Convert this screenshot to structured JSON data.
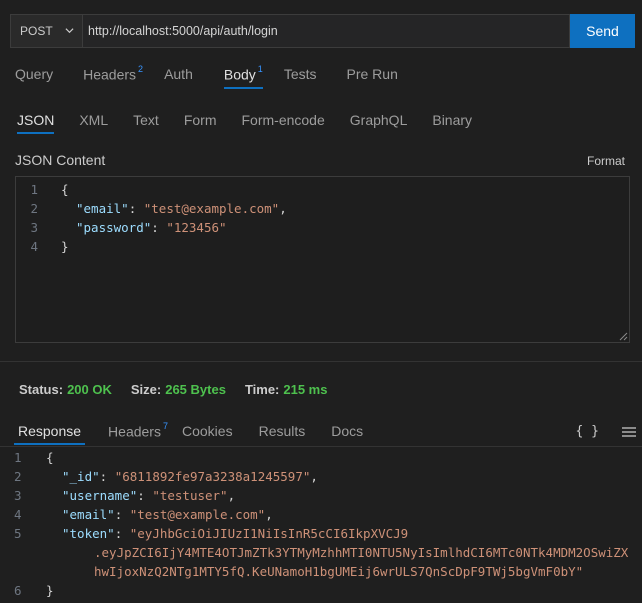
{
  "request": {
    "method": "POST",
    "url": "http://localhost:5000/api/auth/login",
    "send_label": "Send",
    "tabs": [
      {
        "label": "Query",
        "badge": ""
      },
      {
        "label": "Headers",
        "badge": "2"
      },
      {
        "label": "Auth",
        "badge": ""
      },
      {
        "label": "Body",
        "badge": "1"
      },
      {
        "label": "Tests",
        "badge": ""
      },
      {
        "label": "Pre Run",
        "badge": ""
      }
    ],
    "body_types": [
      "JSON",
      "XML",
      "Text",
      "Form",
      "Form-encode",
      "GraphQL",
      "Binary"
    ],
    "content_label": "JSON Content",
    "format_label": "Format",
    "body_lines": [
      {
        "n": "1",
        "open": "{"
      },
      {
        "n": "2",
        "key": "\"email\"",
        "value": "\"test@example.com\"",
        "end": ","
      },
      {
        "n": "3",
        "key": "\"password\"",
        "value": "\"123456\"",
        "end": ""
      },
      {
        "n": "4",
        "open": "}"
      }
    ]
  },
  "status": {
    "status_label": "Status:",
    "status_value": "200 OK",
    "size_label": "Size:",
    "size_value": "265 Bytes",
    "time_label": "Time:",
    "time_value": "215 ms"
  },
  "response": {
    "tabs": [
      {
        "label": "Response",
        "badge": ""
      },
      {
        "label": "Headers",
        "badge": "7"
      },
      {
        "label": "Cookies",
        "badge": ""
      },
      {
        "label": "Results",
        "badge": ""
      },
      {
        "label": "Docs",
        "badge": ""
      }
    ],
    "braces_icon": "{ }",
    "lines": [
      {
        "n": "1",
        "text": "{"
      },
      {
        "n": "2",
        "key": "\"_id\"",
        "value": "\"6811892fe97a3238a1245597\"",
        "end": ","
      },
      {
        "n": "3",
        "key": "\"username\"",
        "value": "\"testuser\"",
        "end": ","
      },
      {
        "n": "4",
        "key": "\"email\"",
        "value": "\"test@example.com\"",
        "end": ","
      },
      {
        "n": "5",
        "key": "\"token\"",
        "value": "\"eyJhbGciOiJIUzI1NiIsInR5cCI6IkpXVCJ9",
        "end": ""
      },
      {
        "n": "",
        "wrap": ".eyJpZCI6IjY4MTE4OTJmZTk3YTMyMzhhMTI0NTU5NyIsImlhdCI6MTc0NTk4MDM2OSwiZX"
      },
      {
        "n": "",
        "wrap": "hwIjoxNzQ2NTg1MTY5fQ.KeUNamoH1bgUMEij6wrULS7QnScDpF9TWj5bgVmF0bY\""
      },
      {
        "n": "6",
        "text": "}"
      }
    ]
  },
  "colors": {
    "accent": "#0e70c0",
    "status_ok": "#4ec14e",
    "json_key": "#9cdcfe",
    "json_string": "#ce9178"
  }
}
